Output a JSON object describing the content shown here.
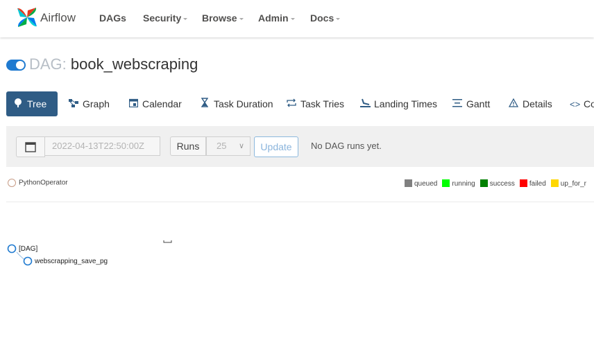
{
  "nav": {
    "brand": "Airflow",
    "items": [
      {
        "label": "DAGs",
        "dropdown": false
      },
      {
        "label": "Security",
        "dropdown": true
      },
      {
        "label": "Browse",
        "dropdown": true
      },
      {
        "label": "Admin",
        "dropdown": true
      },
      {
        "label": "Docs",
        "dropdown": true
      }
    ]
  },
  "page": {
    "title_prefix": "DAG:",
    "dag_id": "book_webscraping",
    "toggle_on": true
  },
  "tabs": [
    {
      "label": "Tree",
      "icon": "tree-icon",
      "active": true
    },
    {
      "label": "Graph",
      "icon": "graph-icon"
    },
    {
      "label": "Calendar",
      "icon": "calendar-icon"
    },
    {
      "label": "Task Duration",
      "icon": "hourglass-icon"
    },
    {
      "label": "Task Tries",
      "icon": "retry-icon"
    },
    {
      "label": "Landing Times",
      "icon": "landing-icon"
    },
    {
      "label": "Gantt",
      "icon": "gantt-icon"
    },
    {
      "label": "Details",
      "icon": "warning-icon"
    },
    {
      "label": "Co",
      "icon": "code-icon"
    }
  ],
  "controls": {
    "base_date": "2022-04-13T22:50:00Z",
    "runs_label": "Runs",
    "runs_value": "25",
    "update_label": "Update",
    "message": "No DAG runs yet."
  },
  "legend": {
    "operator": "PythonOperator",
    "operator_color": "#ffefeb",
    "states": [
      {
        "label": "queued",
        "color": "#808080"
      },
      {
        "label": "running",
        "color": "#00ff00"
      },
      {
        "label": "success",
        "color": "#008000"
      },
      {
        "label": "failed",
        "color": "#ff0000"
      },
      {
        "label": "up_for_r",
        "color": "#ffd700"
      }
    ]
  },
  "tree": {
    "root_label": "[DAG]",
    "task_label": "webscrapping_save_pg"
  }
}
